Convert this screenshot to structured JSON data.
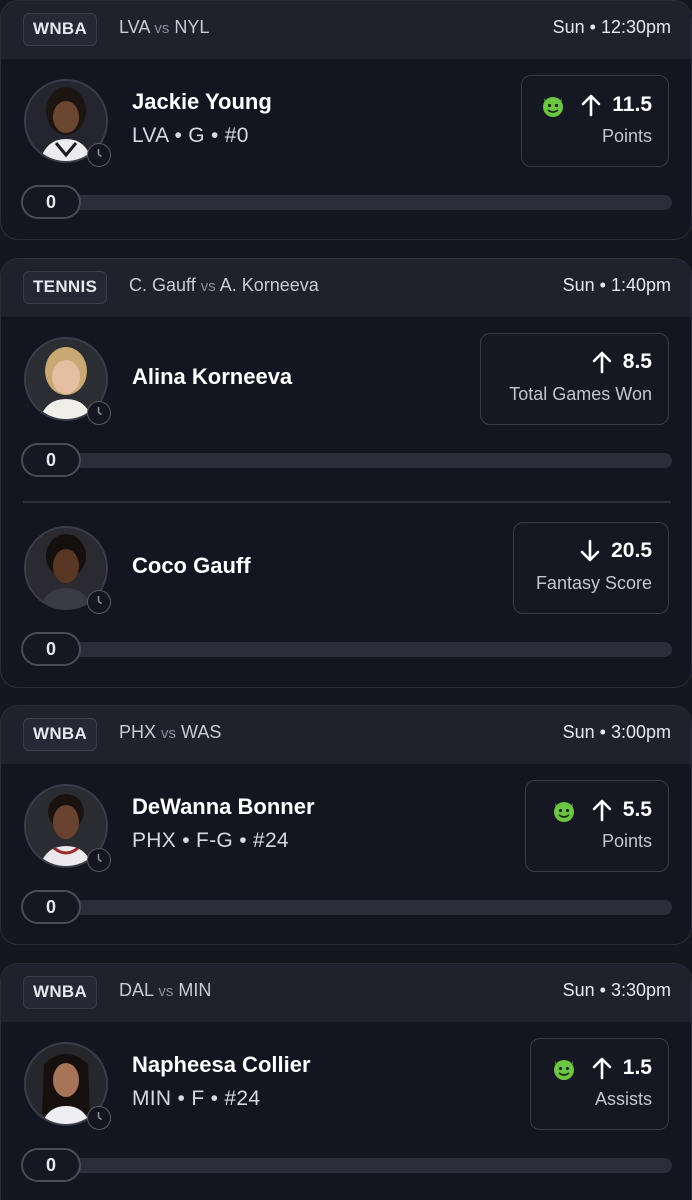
{
  "cards": [
    {
      "league": "WNBA",
      "team_a": "LVA",
      "vs": "vs",
      "team_b": "NYL",
      "time": "Sun • 12:30pm",
      "players": [
        {
          "name": "Jackie Young",
          "meta": "LVA • G • #0",
          "has_demon": true,
          "direction": "up",
          "line": "11.5",
          "stat": "Points",
          "progress": "0",
          "progress_fraction": 0
        }
      ]
    },
    {
      "league": "TENNIS",
      "team_a": "C. Gauff",
      "vs": "vs",
      "team_b": "A. Korneeva",
      "time": "Sun • 1:40pm",
      "players": [
        {
          "name": "Alina Korneeva",
          "meta": "",
          "has_demon": false,
          "direction": "up",
          "line": "8.5",
          "stat": "Total Games Won",
          "progress": "0",
          "progress_fraction": 0
        },
        {
          "name": "Coco Gauff",
          "meta": "",
          "has_demon": false,
          "direction": "down",
          "line": "20.5",
          "stat": "Fantasy Score",
          "progress": "0",
          "progress_fraction": 0
        }
      ]
    },
    {
      "league": "WNBA",
      "team_a": "PHX",
      "vs": "vs",
      "team_b": "WAS",
      "time": "Sun • 3:00pm",
      "players": [
        {
          "name": "DeWanna Bonner",
          "meta": "PHX • F-G • #24",
          "has_demon": true,
          "direction": "up",
          "line": "5.5",
          "stat": "Points",
          "progress": "0",
          "progress_fraction": 0
        }
      ]
    },
    {
      "league": "WNBA",
      "team_a": "DAL",
      "vs": "vs",
      "team_b": "MIN",
      "time": "Sun • 3:30pm",
      "players": [
        {
          "name": "Napheesa Collier",
          "meta": "MIN • F • #24",
          "has_demon": true,
          "direction": "up",
          "line": "1.5",
          "stat": "Assists",
          "progress": "0",
          "progress_fraction": 0
        }
      ]
    }
  ],
  "icons": {
    "demon": "demon-icon",
    "up": "arrow-up-icon",
    "down": "arrow-down-icon",
    "clock": "clock-icon"
  },
  "colors": {
    "background": "#16161e",
    "card": "#131520",
    "header": "#1f212d",
    "demon_green": "#6cc644"
  }
}
